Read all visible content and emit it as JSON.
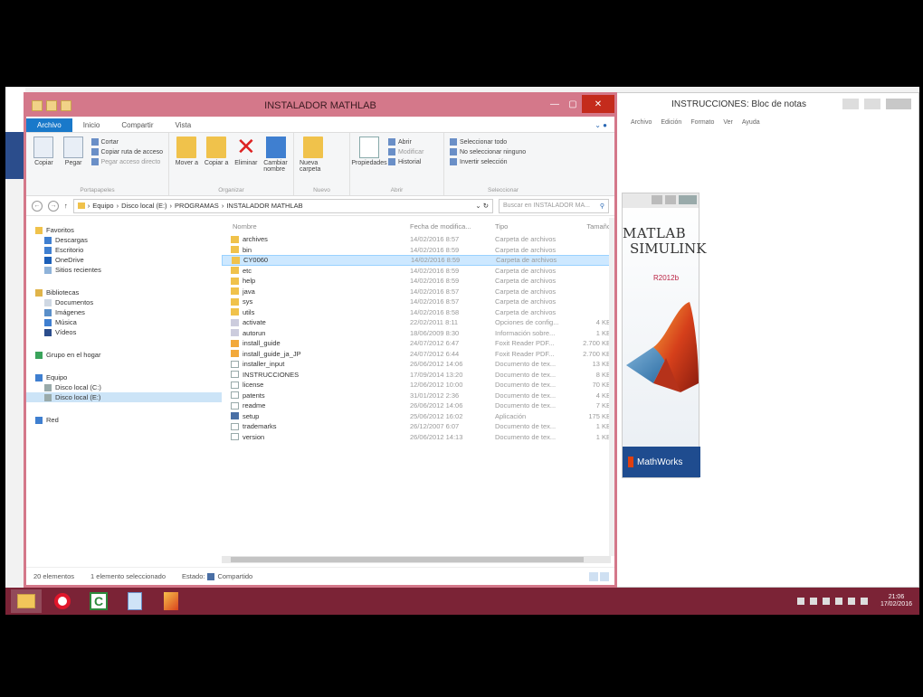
{
  "explorer": {
    "title": "INSTALADOR MATHLAB",
    "tabs": [
      "Archivo",
      "Inicio",
      "Compartir",
      "Vista"
    ],
    "ribbon": {
      "clipboard": {
        "label": "Portapapeles",
        "copy": "Copiar",
        "paste": "Pegar",
        "cut": "Cortar",
        "copy_path": "Copiar ruta de acceso",
        "paste_shortcut": "Pegar acceso directo"
      },
      "organize": {
        "label": "Organizar",
        "move_to": "Mover a",
        "copy_to": "Copiar a",
        "delete": "Eliminar",
        "rename": "Cambiar nombre"
      },
      "new": {
        "label": "Nuevo",
        "new_folder": "Nueva carpeta"
      },
      "open": {
        "label": "Abrir",
        "properties": "Propiedades",
        "open": "Abrir",
        "edit": "Modificar",
        "history": "Historial"
      },
      "select": {
        "label": "Seleccionar",
        "select_all": "Seleccionar todo",
        "select_none": "No seleccionar ninguno",
        "invert": "Invertir selección"
      }
    },
    "address": {
      "crumbs": [
        "Equipo",
        "Disco local (E:)",
        "PROGRAMAS",
        "INSTALADOR MATHLAB"
      ],
      "search_placeholder": "Buscar en INSTALADOR MA..."
    },
    "nav": {
      "favorites": "Favoritos",
      "downloads": "Descargas",
      "desktop": "Escritorio",
      "onedrive": "OneDrive",
      "recent": "Sitios recientes",
      "libraries": "Bibliotecas",
      "documents": "Documentos",
      "pictures": "Imágenes",
      "music": "Música",
      "videos": "Vídeos",
      "homegroup": "Grupo en el hogar",
      "computer": "Equipo",
      "disk_c": "Disco local (C:)",
      "disk_e": "Disco local (E:)",
      "network": "Red"
    },
    "columns": {
      "name": "Nombre",
      "date": "Fecha de modifica...",
      "type": "Tipo",
      "size": "Tamaño"
    },
    "files": [
      {
        "name": "archives",
        "date": "14/02/2016 8:57",
        "type": "Carpeta de archivos",
        "size": "",
        "icon": "folder"
      },
      {
        "name": "bin",
        "date": "14/02/2016 8:59",
        "type": "Carpeta de archivos",
        "size": "",
        "icon": "folder"
      },
      {
        "name": "CY0060",
        "date": "14/02/2016 8:59",
        "type": "Carpeta de archivos",
        "size": "",
        "icon": "folder",
        "selected": true
      },
      {
        "name": "etc",
        "date": "14/02/2016 8:59",
        "type": "Carpeta de archivos",
        "size": "",
        "icon": "folder"
      },
      {
        "name": "help",
        "date": "14/02/2016 8:59",
        "type": "Carpeta de archivos",
        "size": "",
        "icon": "folder"
      },
      {
        "name": "java",
        "date": "14/02/2016 8:57",
        "type": "Carpeta de archivos",
        "size": "",
        "icon": "folder"
      },
      {
        "name": "sys",
        "date": "14/02/2016 8:57",
        "type": "Carpeta de archivos",
        "size": "",
        "icon": "folder"
      },
      {
        "name": "utils",
        "date": "14/02/2016 8:58",
        "type": "Carpeta de archivos",
        "size": "",
        "icon": "folder"
      },
      {
        "name": "activate",
        "date": "22/02/2011 8:11",
        "type": "Opciones de config...",
        "size": "4 KB",
        "icon": "cfg"
      },
      {
        "name": "autorun",
        "date": "18/06/2009 8:30",
        "type": "Información sobre...",
        "size": "1 KB",
        "icon": "cfg"
      },
      {
        "name": "install_guide",
        "date": "24/07/2012 6:47",
        "type": "Foxit Reader PDF...",
        "size": "2.700 KB",
        "icon": "pdf"
      },
      {
        "name": "install_guide_ja_JP",
        "date": "24/07/2012 6:44",
        "type": "Foxit Reader PDF...",
        "size": "2.700 KB",
        "icon": "pdf"
      },
      {
        "name": "installer_input",
        "date": "26/06/2012 14:06",
        "type": "Documento de tex...",
        "size": "13 KB",
        "icon": "file"
      },
      {
        "name": "INSTRUCCIONES",
        "date": "17/09/2014 13:20",
        "type": "Documento de tex...",
        "size": "8 KB",
        "icon": "file"
      },
      {
        "name": "license",
        "date": "12/06/2012 10:00",
        "type": "Documento de tex...",
        "size": "70 KB",
        "icon": "file"
      },
      {
        "name": "patents",
        "date": "31/01/2012 2:36",
        "type": "Documento de tex...",
        "size": "4 KB",
        "icon": "file"
      },
      {
        "name": "readme",
        "date": "26/06/2012 14:06",
        "type": "Documento de tex...",
        "size": "7 KB",
        "icon": "file"
      },
      {
        "name": "setup",
        "date": "25/06/2012 16:02",
        "type": "Aplicación",
        "size": "175 KB",
        "icon": "app"
      },
      {
        "name": "trademarks",
        "date": "26/12/2007 6:07",
        "type": "Documento de tex...",
        "size": "1 KB",
        "icon": "file"
      },
      {
        "name": "version",
        "date": "26/06/2012 14:13",
        "type": "Documento de tex...",
        "size": "1 KB",
        "icon": "file"
      }
    ],
    "status": {
      "count": "20 elementos",
      "selected": "1 elemento seleccionado",
      "state": "Estado:",
      "shared": "Compartido"
    }
  },
  "notepad": {
    "title": "INSTRUCCIONES: Bloc de notas",
    "menu": [
      "Archivo",
      "Edición",
      "Formato",
      "Ver",
      "Ayuda"
    ]
  },
  "splash": {
    "matlab": "MATLAB",
    "simulink": "SIMULINK",
    "version": "R2012b",
    "company": "MathWorks"
  },
  "taskbar": {
    "time": "21:06",
    "date": "17/02/2016"
  },
  "colors": {
    "accent": "#d4788a",
    "taskbar": "#7b2336",
    "selection": "#cde8ff"
  }
}
